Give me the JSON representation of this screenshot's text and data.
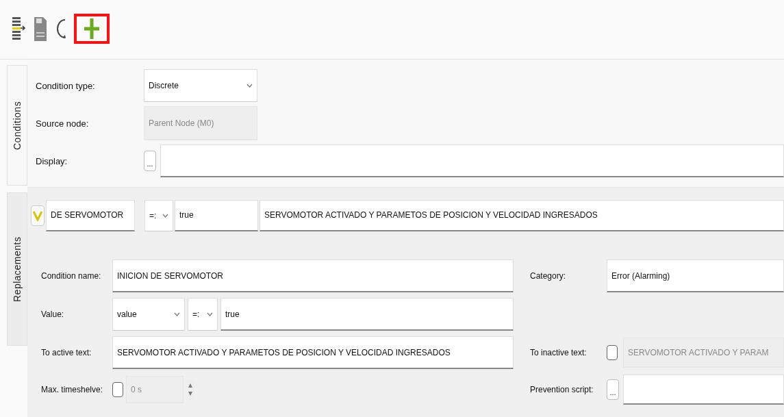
{
  "toolbar": {
    "buttons": [
      {
        "kind": "import",
        "highlighted": false
      },
      {
        "kind": "save",
        "highlighted": false
      },
      {
        "kind": "refresh",
        "highlighted": false
      },
      {
        "kind": "add",
        "highlighted": true
      }
    ]
  },
  "side_tabs": [
    {
      "label": "Conditions",
      "selected": true
    },
    {
      "label": "Replacements",
      "selected": false
    }
  ],
  "conditions_form": {
    "condition_type": {
      "label": "Condition type:",
      "value": "Discrete"
    },
    "source_node": {
      "label": "Source node:",
      "value": "Parent Node (M0)"
    },
    "display": {
      "label": "Display:",
      "button": "..."
    }
  },
  "condition_row": {
    "expanded": true,
    "name": "DE SERVOMOTOR",
    "operator": "=:",
    "value": "true",
    "active_text": "SERVOMOTOR ACTIVADO Y PARAMETOS DE POSICION Y VELOCIDAD INGRESADOS"
  },
  "details": {
    "condition_name": {
      "label": "Condition name:",
      "value": "INICION DE SERVOMOTOR"
    },
    "value": {
      "label": "Value:",
      "source": "value",
      "operator": "=:",
      "value": "true"
    },
    "active_text": {
      "label": "To active text:",
      "value": "SERVOMOTOR ACTIVADO Y PARAMETOS DE POSICION Y VELOCIDAD INGRESADOS"
    },
    "max_timeshelve": {
      "label": "Max. timeshelve:",
      "checked": false,
      "value": "0 s"
    },
    "category": {
      "label": "Category:",
      "value": "Error (Alarming)"
    },
    "inactive_text": {
      "label": "To inactive text:",
      "checked": false,
      "value": "SERVOMOTOR ACTIVADO Y PARAM"
    },
    "prevention_script": {
      "label": "Prevention script:",
      "button": "..."
    }
  }
}
